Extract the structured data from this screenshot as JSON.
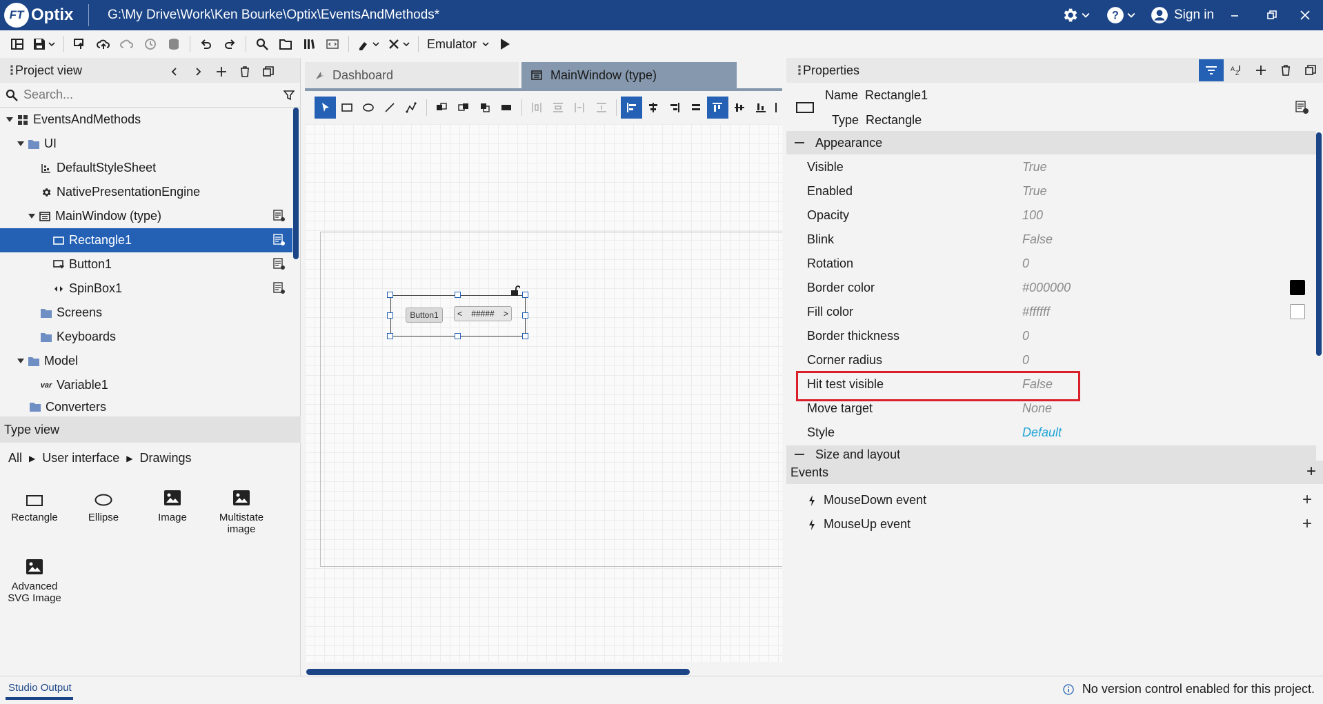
{
  "titlebar": {
    "logo_badge": "FT",
    "app_name": "Optix",
    "path": "G:\\My Drive\\Work\\Ken Bourke\\Optix\\EventsAndMethods*",
    "sign_in": "Sign in"
  },
  "toolbar": {
    "emulator_label": "Emulator"
  },
  "project_view": {
    "title": "Project view",
    "search_placeholder": "Search...",
    "tree": [
      {
        "label": "EventsAndMethods",
        "icon": "project-icon"
      },
      {
        "label": "UI",
        "icon": "folder-icon"
      },
      {
        "label": "DefaultStyleSheet",
        "icon": "stylesheet-icon"
      },
      {
        "label": "NativePresentationEngine",
        "icon": "gear-icon"
      },
      {
        "label": "MainWindow (type)",
        "icon": "window-icon"
      },
      {
        "label": "Rectangle1",
        "icon": "rectangle-icon"
      },
      {
        "label": "Button1",
        "icon": "button-icon"
      },
      {
        "label": "SpinBox1",
        "icon": "spinbox-icon"
      },
      {
        "label": "Screens",
        "icon": "folder-icon"
      },
      {
        "label": "Keyboards",
        "icon": "folder-icon"
      },
      {
        "label": "Model",
        "icon": "folder-icon"
      },
      {
        "label": "Variable1",
        "icon": "variable-icon",
        "badge": "var"
      },
      {
        "label": "Converters",
        "icon": "folder-icon"
      }
    ]
  },
  "type_view": {
    "title": "Type view",
    "breadcrumb": [
      "All",
      "User interface",
      "Drawings"
    ],
    "items": [
      {
        "label": "Rectangle",
        "icon": "rectangle-icon"
      },
      {
        "label": "Ellipse",
        "icon": "ellipse-icon"
      },
      {
        "label": "Image",
        "icon": "image-icon"
      },
      {
        "label": "Multistate image",
        "icon": "image-icon"
      },
      {
        "label": "Advanced SVG Image",
        "icon": "image-icon"
      }
    ]
  },
  "editor": {
    "tabs": [
      {
        "label": "Dashboard",
        "active": false
      },
      {
        "label": "MainWindow (type)",
        "active": true
      }
    ],
    "canvas": {
      "button_label": "Button1",
      "spinbox_value": "#####",
      "spinbox_left": "<",
      "spinbox_right": ">"
    }
  },
  "properties": {
    "title": "Properties",
    "name_label": "Name",
    "name_value": "Rectangle1",
    "type_label": "Type",
    "type_value": "Rectangle",
    "appearance_title": "Appearance",
    "rows": [
      {
        "name": "Visible",
        "value": "True"
      },
      {
        "name": "Enabled",
        "value": "True"
      },
      {
        "name": "Opacity",
        "value": "100"
      },
      {
        "name": "Blink",
        "value": "False"
      },
      {
        "name": "Rotation",
        "value": "0"
      },
      {
        "name": "Border color",
        "value": "#000000",
        "swatch": "#000000"
      },
      {
        "name": "Fill color",
        "value": "#ffffff",
        "swatch": "#ffffff"
      },
      {
        "name": "Border thickness",
        "value": "0"
      },
      {
        "name": "Corner radius",
        "value": "0"
      },
      {
        "name": "Hit test visible",
        "value": "False",
        "highlighted": true
      },
      {
        "name": "Move target",
        "value": "None"
      },
      {
        "name": "Style",
        "value": "Default",
        "link": true
      }
    ],
    "size_layout_title": "Size and layout",
    "events_title": "Events",
    "events": [
      {
        "label": "MouseDown event"
      },
      {
        "label": "MouseUp event"
      }
    ]
  },
  "statusbar": {
    "output_tab": "Studio Output",
    "message": "No version control enabled for this project."
  },
  "colors": {
    "titlebar": "#1b4587",
    "selection": "#2461b5",
    "highlight_box": "#d9202a",
    "link": "#21a4d6"
  }
}
